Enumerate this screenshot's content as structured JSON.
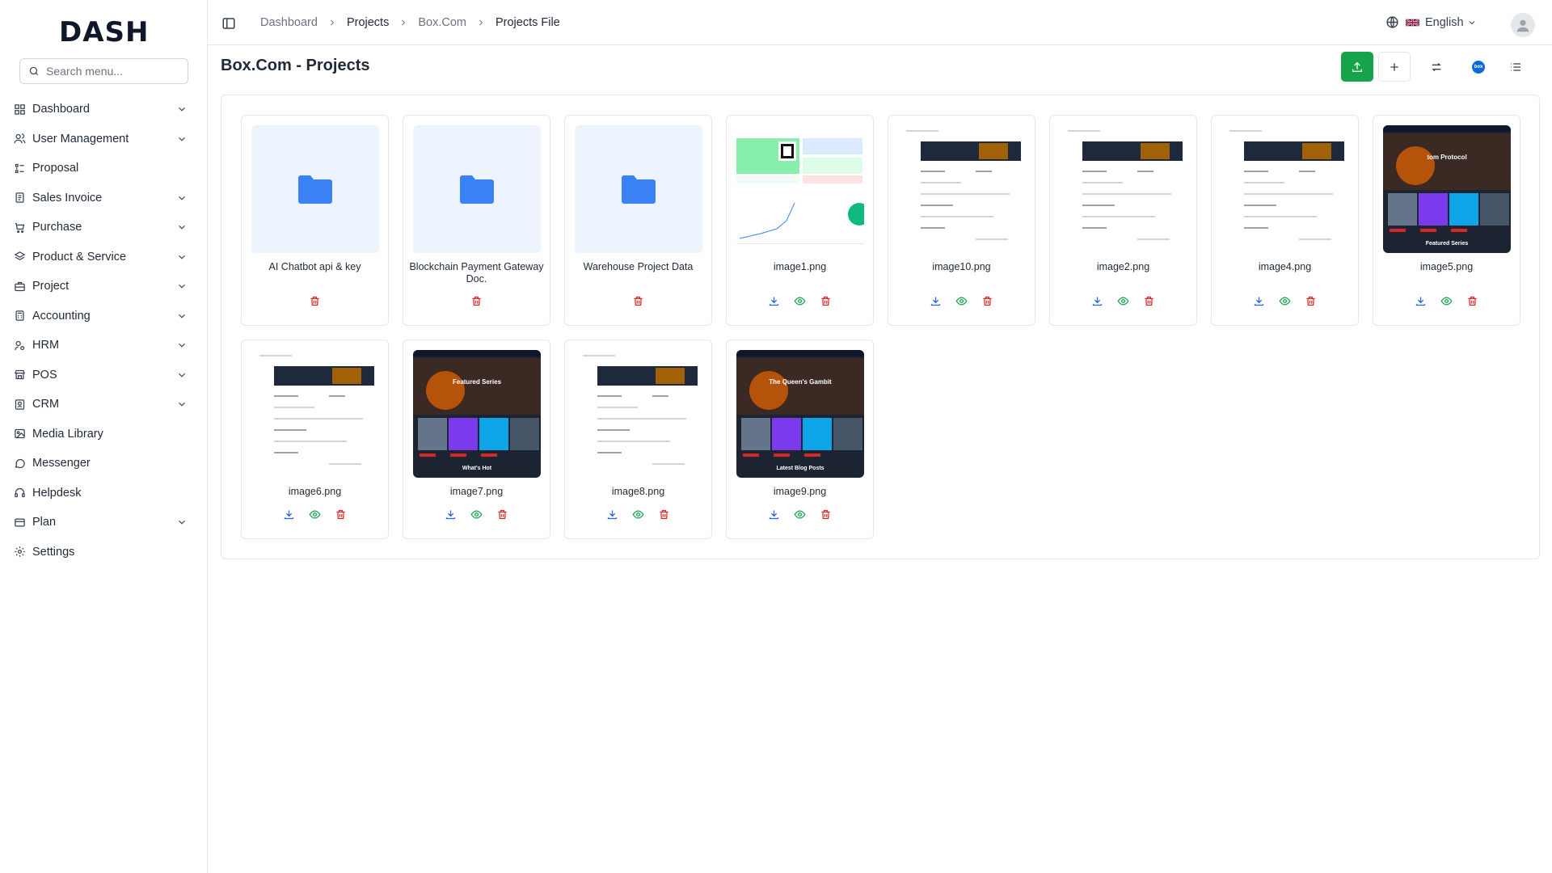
{
  "app": {
    "logo_text": "DASH"
  },
  "search": {
    "placeholder": "Search menu..."
  },
  "sidebar": {
    "items": [
      {
        "label": "Dashboard",
        "icon": "grid-icon",
        "expandable": true
      },
      {
        "label": "User Management",
        "icon": "users-icon",
        "expandable": true
      },
      {
        "label": "Proposal",
        "icon": "proposal-icon",
        "expandable": false
      },
      {
        "label": "Sales Invoice",
        "icon": "invoice-icon",
        "expandable": true
      },
      {
        "label": "Purchase",
        "icon": "cart-icon",
        "expandable": true
      },
      {
        "label": "Product & Service",
        "icon": "layers-icon",
        "expandable": true
      },
      {
        "label": "Project",
        "icon": "briefcase-icon",
        "expandable": true
      },
      {
        "label": "Accounting",
        "icon": "calculator-icon",
        "expandable": true
      },
      {
        "label": "HRM",
        "icon": "user-cog-icon",
        "expandable": true
      },
      {
        "label": "POS",
        "icon": "store-icon",
        "expandable": true
      },
      {
        "label": "CRM",
        "icon": "contact-icon",
        "expandable": true
      },
      {
        "label": "Media Library",
        "icon": "image-icon",
        "expandable": false
      },
      {
        "label": "Messenger",
        "icon": "message-icon",
        "expandable": false
      },
      {
        "label": "Helpdesk",
        "icon": "headphones-icon",
        "expandable": false
      },
      {
        "label": "Plan",
        "icon": "credit-card-icon",
        "expandable": true
      },
      {
        "label": "Settings",
        "icon": "gear-icon",
        "expandable": false
      }
    ]
  },
  "breadcrumb": [
    {
      "label": "Dashboard",
      "style": "muted"
    },
    {
      "label": "Projects",
      "style": "dark"
    },
    {
      "label": "Box.Com",
      "style": "muted"
    },
    {
      "label": "Projects File",
      "style": "dark"
    }
  ],
  "header": {
    "language": "English"
  },
  "page": {
    "title": "Box.Com - Projects"
  },
  "colors": {
    "accent": "#16a34a",
    "folder": "#3b82f6",
    "download": "#2563eb",
    "view": "#16a34a",
    "delete": "#dc2626"
  },
  "files": [
    {
      "name": "AI Chatbot api & key",
      "kind": "folder"
    },
    {
      "name": "Blockchain Payment Gateway Doc.",
      "kind": "folder"
    },
    {
      "name": "Warehouse Project Data",
      "kind": "folder"
    },
    {
      "name": "image1.png",
      "kind": "image",
      "preview": "dashboard-light"
    },
    {
      "name": "image10.png",
      "kind": "image",
      "preview": "form-light"
    },
    {
      "name": "image2.png",
      "kind": "image",
      "preview": "form-light"
    },
    {
      "name": "image4.png",
      "kind": "image",
      "preview": "form-light"
    },
    {
      "name": "image5.png",
      "kind": "image",
      "preview": "movie-dark",
      "preview_text": [
        "tom Protocol",
        "Featured Series"
      ]
    },
    {
      "name": "image6.png",
      "kind": "image",
      "preview": "form-light"
    },
    {
      "name": "image7.png",
      "kind": "image",
      "preview": "movie-dark",
      "preview_text": [
        "Featured Series",
        "What's Hot"
      ]
    },
    {
      "name": "image8.png",
      "kind": "image",
      "preview": "form-light"
    },
    {
      "name": "image9.png",
      "kind": "image",
      "preview": "movie-dark",
      "preview_text": [
        "The Queen's Gambit",
        "Latest Blog Posts"
      ]
    }
  ]
}
